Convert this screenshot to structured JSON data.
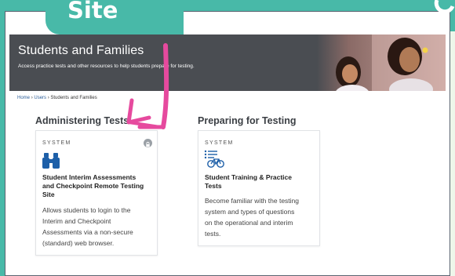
{
  "overlay": {
    "tab_label": "Site"
  },
  "hero": {
    "title": "Students and Families",
    "subtitle": "Access practice tests and other resources to help students prepare for testing."
  },
  "breadcrumb": {
    "home": "Home",
    "sep": "›",
    "users": "Users",
    "current": "Students and Families"
  },
  "sections": [
    {
      "title": "Administering Tests",
      "card": {
        "tag": "SYSTEM",
        "title_lines": [
          "Student Interim Assessments",
          "and Checkpoint Remote Testing",
          "Site"
        ],
        "desc_lines": [
          "Allows students to login to the",
          "Interim and Checkpoint",
          "Assessments via a non-secure",
          "(standard) web browser."
        ]
      }
    },
    {
      "title": "Preparing for Testing",
      "card": {
        "tag": "SYSTEM",
        "title_lines": [
          "Student Training & Practice",
          "Tests"
        ],
        "desc_lines": [
          "Become familiar with the testing",
          "system and types of questions",
          "on the operational and interim",
          "tests."
        ]
      }
    }
  ],
  "colors": {
    "teal": "#48b9a8",
    "hero_bg": "#4a4d52",
    "arrow": "#e64a9e",
    "icon_blue": "#1d5fa8"
  }
}
